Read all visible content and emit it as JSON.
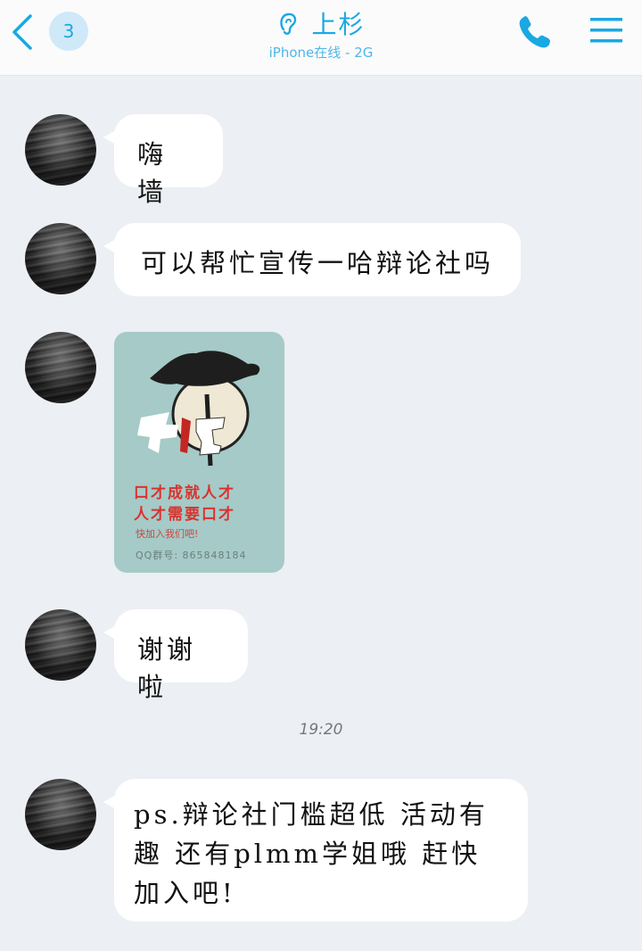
{
  "header": {
    "unread_count": "3",
    "title": "上杉",
    "subtitle": "iPhone在线 - 2G",
    "accent_color": "#1aa8e2",
    "icons": [
      "back-chevron-icon",
      "ear-icon",
      "phone-icon",
      "menu-icon"
    ]
  },
  "messages": [
    {
      "type": "text",
      "text": "嗨 墙"
    },
    {
      "type": "text",
      "text": "可以帮忙宣传一哈辩论社吗"
    },
    {
      "type": "image",
      "slogan_line1": "口才成就人才",
      "slogan_line2": "人才需要口才",
      "join_text": "快加入我们吧!",
      "qq_group": "QQ群号: 865848184"
    },
    {
      "type": "text",
      "text": "谢谢啦"
    },
    {
      "type": "text",
      "text": "ps.辩论社门槛超低 活动有趣 还有plmm学姐哦 赶快加入吧!"
    }
  ],
  "timestamp": "19:20"
}
